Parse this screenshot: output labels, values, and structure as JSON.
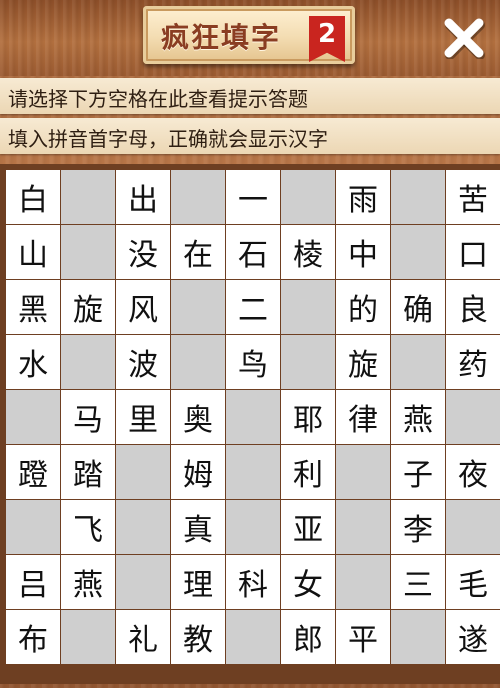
{
  "header": {
    "title": "疯狂填字",
    "level_badge": "2"
  },
  "hints": {
    "line1": "请选择下方空格在此查看提示答题",
    "line2": "填入拼音首字母，正确就会显示汉字"
  },
  "icons": {
    "close": "close-icon"
  },
  "colors": {
    "badge": "#c9251f",
    "empty_cell": "#cfcfcf",
    "filled_cell": "#ffffff"
  },
  "grid": {
    "rows": [
      [
        "白",
        "",
        "出",
        "",
        "一",
        "",
        "雨",
        "",
        "苦"
      ],
      [
        "山",
        "",
        "没",
        "在",
        "石",
        "棱",
        "中",
        "",
        "口"
      ],
      [
        "黑",
        "旋",
        "风",
        "",
        "二",
        "",
        "的",
        "确",
        "良"
      ],
      [
        "水",
        "",
        "波",
        "",
        "鸟",
        "",
        "旋",
        "",
        "药"
      ],
      [
        "",
        "马",
        "里",
        "奥",
        "",
        "耶",
        "律",
        "燕",
        ""
      ],
      [
        "蹬",
        "踏",
        "",
        "姆",
        "",
        "利",
        "",
        "子",
        "夜"
      ],
      [
        "",
        "飞",
        "",
        "真",
        "",
        "亚",
        "",
        "李",
        ""
      ],
      [
        "吕",
        "燕",
        "",
        "理",
        "科",
        "女",
        "",
        "三",
        "毛"
      ],
      [
        "布",
        "",
        "礼",
        "教",
        "",
        "郎",
        "平",
        "",
        "遂"
      ]
    ]
  }
}
